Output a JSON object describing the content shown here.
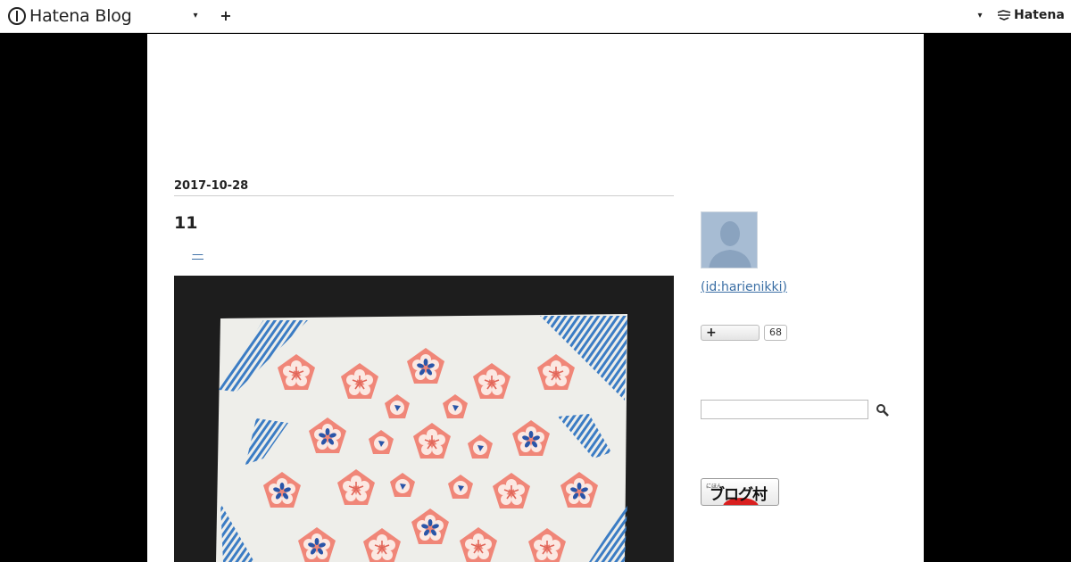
{
  "topbar": {
    "logo_text": "Hatena Blog",
    "dropdown_glyph": "▾",
    "add_glyph": "+",
    "right_dropdown_glyph": "▾",
    "hatena_text": "Hatena"
  },
  "entry": {
    "date": "2017-10-28",
    "title": "11",
    "link_text": "—",
    "photo_icon": "craft-photo-flower-stamps"
  },
  "sidebar": {
    "profile_id": "(id:harienikki)",
    "subscribe_glyph": "+",
    "subscriber_count": "68",
    "search_placeholder": "",
    "banner_small": "にほん",
    "banner_text": "ブログ村"
  },
  "colors": {
    "accent_link": "#3b6fa5",
    "background": "#000000",
    "panel": "#ffffff",
    "flower_pink": "#f08678",
    "flower_blue": "#2a55a8"
  }
}
